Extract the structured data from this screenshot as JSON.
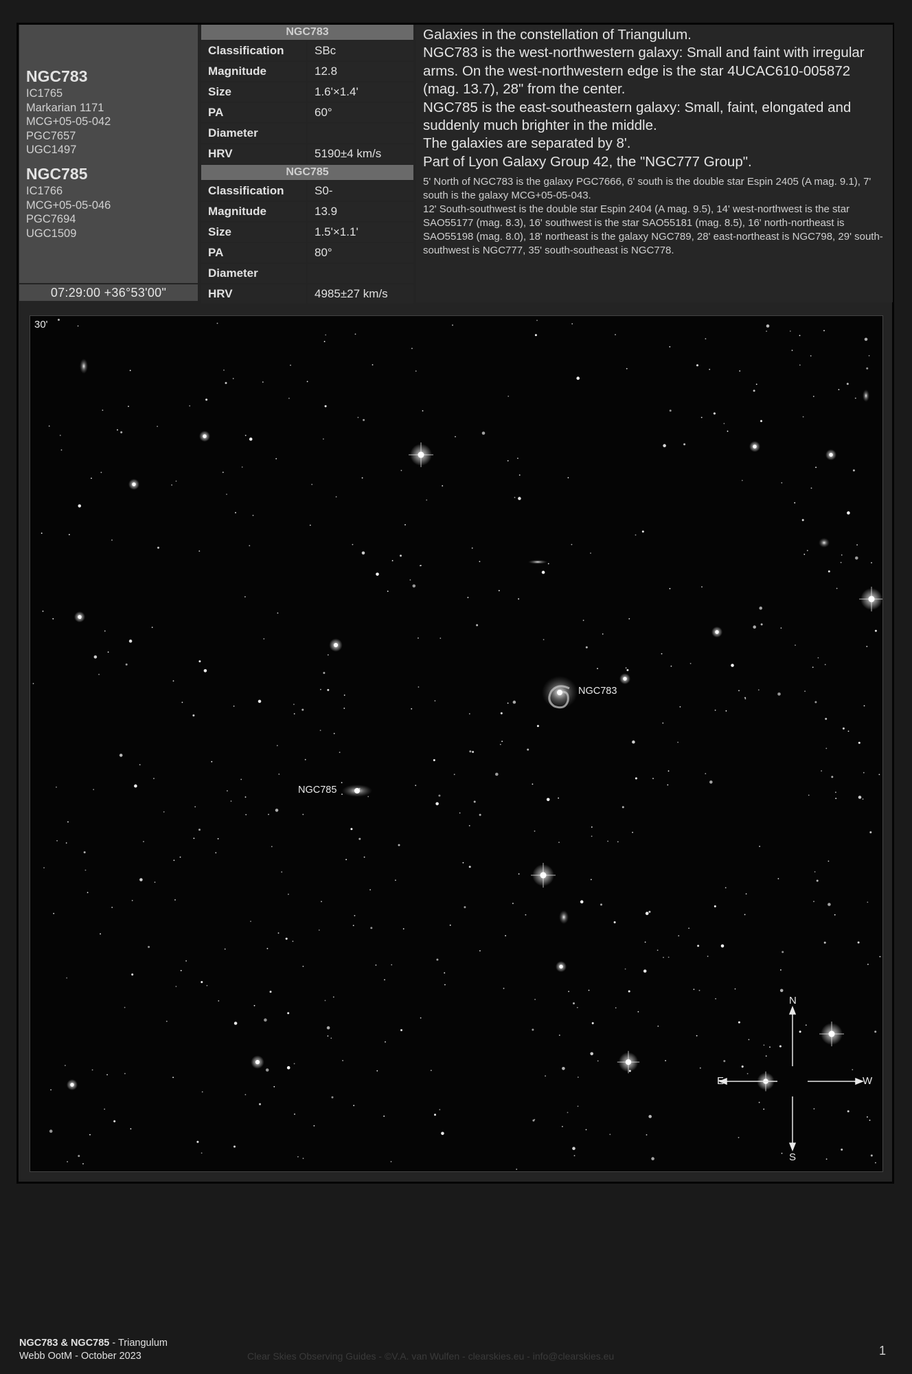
{
  "objects": {
    "first": {
      "name": "NGC783",
      "aliases": [
        "IC1765",
        "Markarian 1171",
        "MCG+05-05-042",
        "PGC7657",
        "UGC1497"
      ]
    },
    "second": {
      "name": "NGC785",
      "aliases": [
        "IC1766",
        "MCG+05-05-046",
        "PGC7694",
        "UGC1509"
      ]
    }
  },
  "coordinates": "07:29:00 +36°53'00\"",
  "table_ngc783": {
    "title": "NGC783",
    "rows": [
      {
        "key": "Classification",
        "value": "SBc"
      },
      {
        "key": "Magnitude",
        "value": "12.8"
      },
      {
        "key": "Size",
        "value": "1.6'×1.4'"
      },
      {
        "key": "PA",
        "value": "60°"
      },
      {
        "key": "Diameter",
        "value": ""
      },
      {
        "key": "HRV",
        "value": "5190±4 km/s"
      }
    ]
  },
  "table_ngc785": {
    "title": "NGC785",
    "rows": [
      {
        "key": "Classification",
        "value": "S0-"
      },
      {
        "key": "Magnitude",
        "value": "13.9"
      },
      {
        "key": "Size",
        "value": "1.5'×1.1'"
      },
      {
        "key": "PA",
        "value": "80°"
      },
      {
        "key": "Diameter",
        "value": ""
      },
      {
        "key": "HRV",
        "value": "4985±27 km/s"
      }
    ]
  },
  "description": {
    "main": [
      "Galaxies in the constellation of Triangulum.",
      "NGC783 is the west-northwestern galaxy: Small and faint with irregular arms. On the west-northwestern edge is the star 4UCAC610-005872 (mag. 13.7), 28\" from the center.",
      "NGC785 is the east-southeastern galaxy: Small, faint, elongated and suddenly much brighter in the middle.",
      "The galaxies are separated by 8'.",
      "Part of Lyon Galaxy Group 42, the \"NGC777 Group\"."
    ],
    "details": [
      "5' North of NGC783 is the galaxy PGC7666, 6' south is the double star Espin 2405 (A mag. 9.1), 7' south is the galaxy MCG+05-05-043.",
      "12' South-southwest is the double star Espin 2404 (A mag. 9.5), 14' west-northwest is the star SAO55177 (mag. 8.3), 16' southwest is the star SAO55181 (mag. 8.5), 16' north-northeast is SAO55198 (mag. 8.0), 18' northeast is the galaxy NGC789, 28' east-northeast is NGC798, 29' south-southwest is NGC777, 35' south-southeast is NGC778."
    ]
  },
  "image": {
    "scale_label": "30'",
    "galaxy_labels": [
      "NGC783",
      "NGC785"
    ],
    "compass": {
      "north": "N",
      "south": "S",
      "east": "E",
      "west": "W"
    }
  },
  "footer": {
    "title_bold": "NGC783 & NGC785",
    "title_rest": " - Triangulum",
    "subtitle": "Webb OotM - October 2023",
    "credits": "Clear Skies Observing Guides - ©V.A. van Wulfen - clearskies.eu - info@clearskies.eu",
    "page_number": "1"
  }
}
